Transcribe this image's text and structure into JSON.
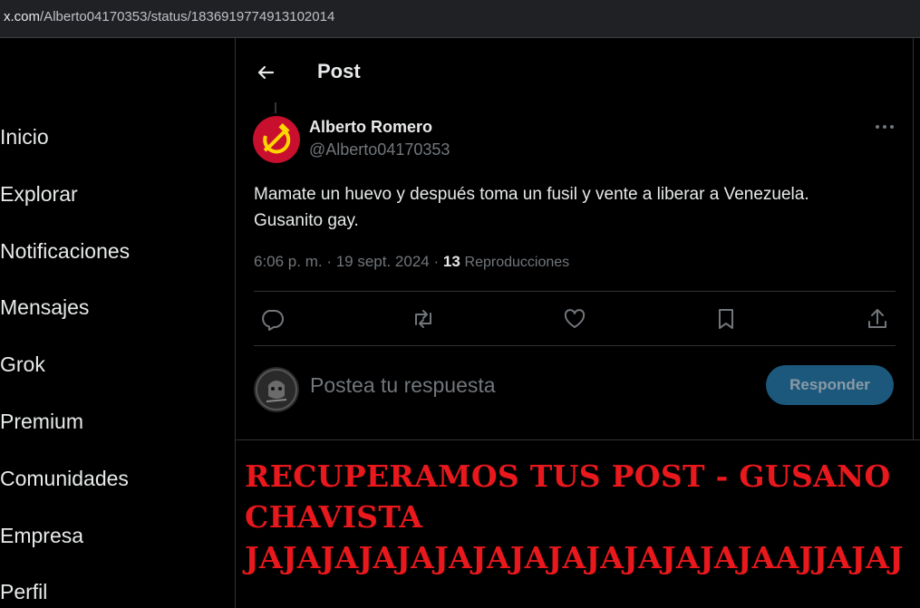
{
  "browser": {
    "url_host": "x.com",
    "url_path": "/Alberto04170353/status/1836919774913102014"
  },
  "sidebar": {
    "items": [
      {
        "label": "Inicio"
      },
      {
        "label": "Explorar"
      },
      {
        "label": "Notificaciones"
      },
      {
        "label": "Mensajes"
      },
      {
        "label": "Grok"
      },
      {
        "label": "Premium"
      },
      {
        "label": "Comunidades"
      },
      {
        "label": "Empresa"
      },
      {
        "label": "Perfil"
      }
    ]
  },
  "header": {
    "title": "Post",
    "back_icon": "arrow-left-icon"
  },
  "post": {
    "author_name": "Alberto Romero",
    "author_handle": "@Alberto04170353",
    "avatar_icon": "hammer-sickle-icon",
    "text_line1": "Mamate un huevo y después toma un fusil y vente a liberar a Venezuela.",
    "text_line2": "Gusanito gay.",
    "time": "6:06 p. m.",
    "date": "19 sept. 2024",
    "views_count": "13",
    "views_label": "Reproducciones",
    "actions": [
      "reply-icon",
      "repost-icon",
      "like-icon",
      "bookmark-icon",
      "share-icon"
    ]
  },
  "reply": {
    "placeholder": "Postea tu respuesta",
    "button_label": "Responder",
    "avatar_text": "ANONYMOUS"
  },
  "banner": {
    "line1": "RECUPERAMOS TUS POST - GUSANO",
    "line2": "CHAVISTA",
    "line3": "JAJAJAJAJAJAJAJAJAJAJAJAJAJAAJJAJAJ"
  },
  "colors": {
    "background": "#000000",
    "text": "#e7e9ea",
    "muted": "#71767b",
    "button": "#1b587c",
    "banner_red": "#e8181c",
    "avatar_red": "#c8102e",
    "avatar_gold": "#ffd700"
  }
}
